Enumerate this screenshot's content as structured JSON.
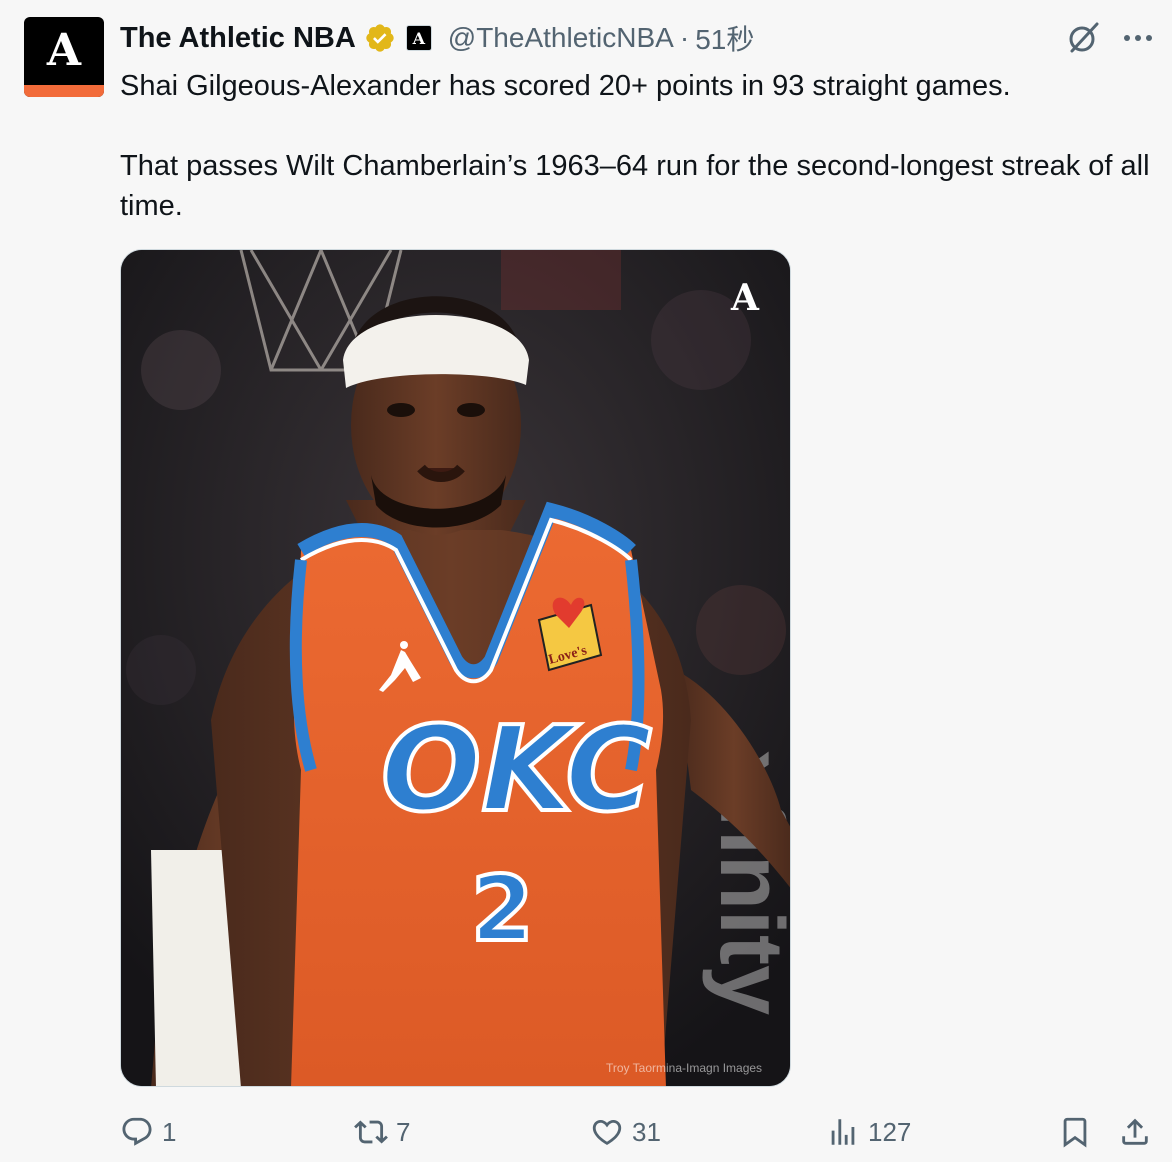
{
  "tweet": {
    "display_name": "The Athletic NBA",
    "handle": "@TheAthleticNBA",
    "separator": "·",
    "time": "51秒",
    "avatar_letter": "A",
    "affiliate_letter": "A",
    "text_line_1": "Shai Gilgeous-Alexander has scored 20+ points in 93 straight games.",
    "text_line_2": "That passes Wilt Chamberlain’s 1963–64 run for the second-longest streak of all time."
  },
  "media": {
    "watermark_letter": "A",
    "jersey_text": "OKC",
    "jersey_number": "2",
    "patch_text": "Love's",
    "credit": "Troy Taormina-Imagn Images",
    "arena_sign": "xfinity"
  },
  "actions": {
    "replies": "1",
    "reposts": "7",
    "likes": "31",
    "views": "127"
  },
  "colors": {
    "brand_orange": "#f26b3a",
    "jersey_orange": "#e8642e",
    "jersey_blue": "#2e7fd0",
    "muted_text": "#536471",
    "verified_gold": "#e2b719"
  },
  "icons": {
    "grok": "grok-icon",
    "more": "more-icon",
    "reply": "reply-icon",
    "retweet": "retweet-icon",
    "like": "heart-icon",
    "views": "views-icon",
    "bookmark": "bookmark-icon",
    "share": "share-icon"
  }
}
